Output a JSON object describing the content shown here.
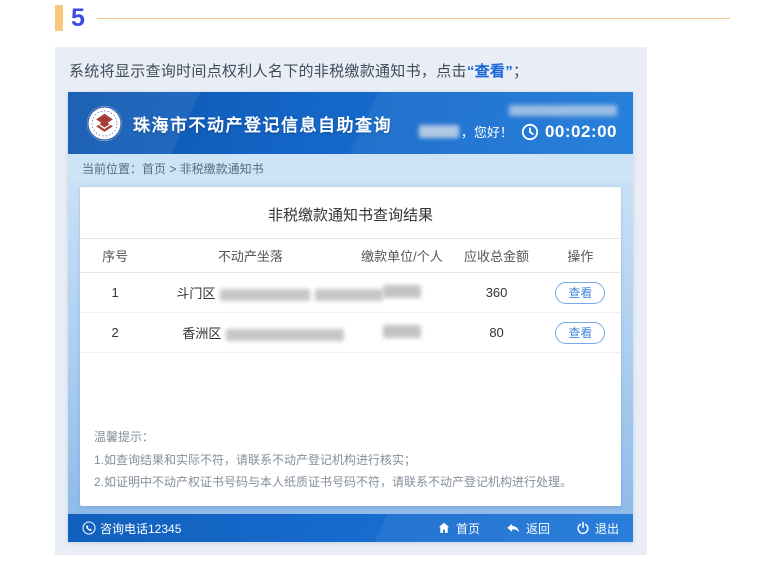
{
  "step": {
    "number": "5",
    "instruction_prefix": "系统将显示查询时间点权利人名下的非税缴款通知书，点击",
    "instruction_highlight": "“查看”",
    "instruction_suffix": "；"
  },
  "app": {
    "header": {
      "title": "珠海市不动产登记信息自助查询",
      "greeting": "，您好！",
      "timer": "00:02:00",
      "clock_icon": "clock-icon",
      "redacted": [
        "office-name-redacted",
        "user-name-redacted"
      ]
    },
    "breadcrumb": {
      "text": "当前位置：首页 > 非税缴款通知书"
    },
    "result": {
      "title": "非税缴款通知书查询结果",
      "table": {
        "headers": [
          "序号",
          "不动产坐落",
          "缴款单位/个人",
          "应收总金额",
          "操作"
        ],
        "rows": [
          {
            "no": "1",
            "location_prefix": "斗门区",
            "location_redacted": true,
            "payer_redacted": true,
            "amount": "360",
            "action": "查看"
          },
          {
            "no": "2",
            "location_prefix": "香洲区",
            "location_redacted": true,
            "payer_redacted": true,
            "amount": "80",
            "action": "查看"
          }
        ]
      },
      "tips": {
        "title": "温馨提示：",
        "lines": [
          "1.如查询结果和实际不符，请联系不动产登记机构进行核实；",
          "2.如证明中不动产权证书号码与本人纸质证书号码不符，请联系不动产登记机构进行处理。"
        ]
      }
    },
    "footer": {
      "phone": "咨询电话12345",
      "phone_icon": "phone-icon",
      "home": "首页",
      "back": "返回",
      "exit": "退出"
    }
  },
  "colors": {
    "step_number": "#3c4be0",
    "accent_bar": "#f9c87f",
    "rule_line": "#f2c489",
    "instruction_highlight": "#1b66d9",
    "panel_bg": "#e9eef6",
    "header_blue_start": "#0d55ae",
    "header_blue_end": "#1d7ad9",
    "breadcrumb_bg": "#cde4f7",
    "body_gradient_top": "#c9e0f6",
    "body_gradient_bottom": "#8fbbe9",
    "view_button_border": "#78aae4",
    "view_button_text": "#3f87d6",
    "footer_blue": "#1467c4"
  }
}
